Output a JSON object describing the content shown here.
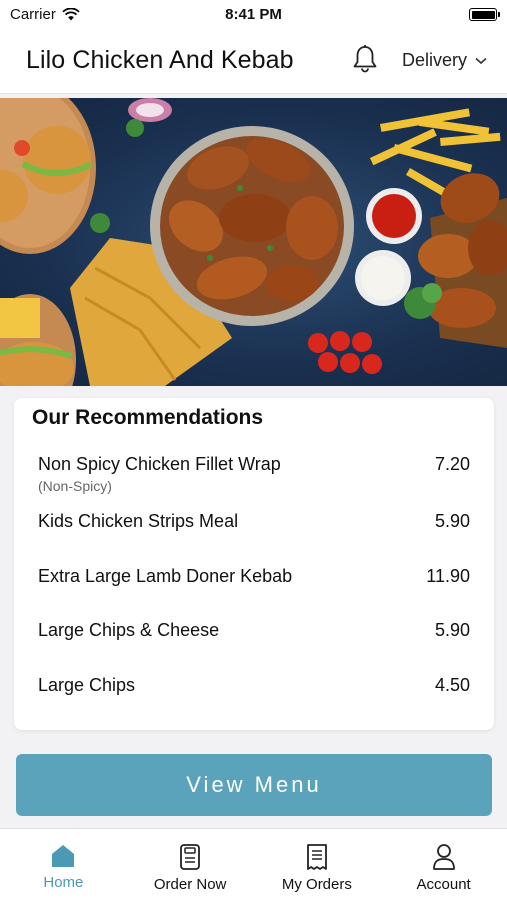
{
  "status_bar": {
    "carrier": "Carrier",
    "time": "8:41 PM"
  },
  "header": {
    "title": "Lilo Chicken And Kebab",
    "delivery_label": "Delivery"
  },
  "recommendations": {
    "title": "Our Recommendations",
    "items": [
      {
        "name": "Non Spicy Chicken Fillet Wrap",
        "note": "(Non-Spicy)",
        "price": "7.20"
      },
      {
        "name": "Kids Chicken Strips Meal",
        "price": "5.90"
      },
      {
        "name": "Extra Large Lamb Doner Kebab",
        "price": "11.90"
      },
      {
        "name": "Large Chips & Cheese",
        "price": "5.90"
      },
      {
        "name": "Large Chips",
        "price": "4.50"
      }
    ]
  },
  "view_menu_label": "View Menu",
  "tabs": [
    {
      "label": "Home",
      "icon": "home-icon",
      "active": true
    },
    {
      "label": "Order Now",
      "icon": "order-icon"
    },
    {
      "label": "My Orders",
      "icon": "receipt-icon"
    },
    {
      "label": "Account",
      "icon": "person-icon"
    }
  ],
  "colors": {
    "accent": "#5ba3ba",
    "tab_active": "#4a9ab5",
    "hero_bg": "#1f3a5c"
  }
}
